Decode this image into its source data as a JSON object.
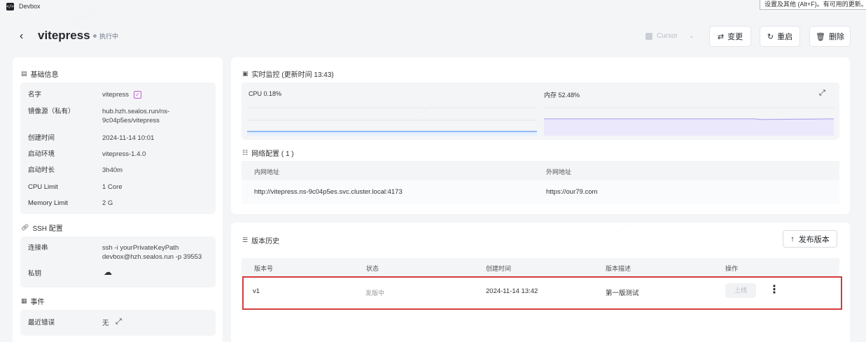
{
  "window": {
    "app_title": "Devbox",
    "tooltip": "设置及其他 (Alt+F)。有可用的更新。"
  },
  "header": {
    "title": "vitepress",
    "status": "执行中",
    "ide": "Cursor",
    "change_label": "变更",
    "restart_label": "重启",
    "delete_label": "删除"
  },
  "basic": {
    "title": "基础信息",
    "rows": [
      {
        "key": "名字",
        "value": "vitepress"
      },
      {
        "key": "镜像源（私有）",
        "value": "hub.hzh.sealos.run/ns-9c04p5es/vitepress"
      },
      {
        "key": "创建时间",
        "value": "2024-11-14 10:01"
      },
      {
        "key": "启动环境",
        "value": "vitepress-1.4.0"
      },
      {
        "key": "启动时长",
        "value": "3h40m"
      },
      {
        "key": "CPU Limit",
        "value": "1 Core"
      },
      {
        "key": "Memory Limit",
        "value": "2 G"
      }
    ]
  },
  "ssh": {
    "title": "SSH 配置",
    "conn_key": "连接串",
    "conn_value": "ssh -i yourPrivateKeyPath devbox@hzh.sealos.run -p 39553",
    "private_key": "私钥"
  },
  "events": {
    "title": "事件",
    "key": "最近错误",
    "value": "无"
  },
  "monitor": {
    "title": "实时监控 (更新时间 13:43)",
    "cpu_label": "CPU 0.18%",
    "mem_label": "内存 52.48%",
    "cpu_percent": 0.18,
    "mem_percent": 52.48
  },
  "network": {
    "title": "网络配置 ( 1 )",
    "headers": [
      "内网地址",
      "外网地址"
    ],
    "rows": [
      [
        "http://vitepress.ns-9c04p5es.svc.cluster.local:4173",
        "https://our79.com"
      ]
    ]
  },
  "versions": {
    "title": "版本历史",
    "publish_label": "发布版本",
    "headers": [
      "版本号",
      "状态",
      "创建时间",
      "版本描述",
      "操作"
    ],
    "rows": [
      {
        "version": "v1",
        "status": "发版中",
        "created": "2024-11-14 13:42",
        "description": "第一版测试",
        "action": "上线"
      }
    ]
  },
  "colors": {
    "cpu_line": "#3b82f6",
    "mem_fill": "#ece8fb",
    "mem_line": "#8b7fd8",
    "highlight": "#d23c3c"
  }
}
